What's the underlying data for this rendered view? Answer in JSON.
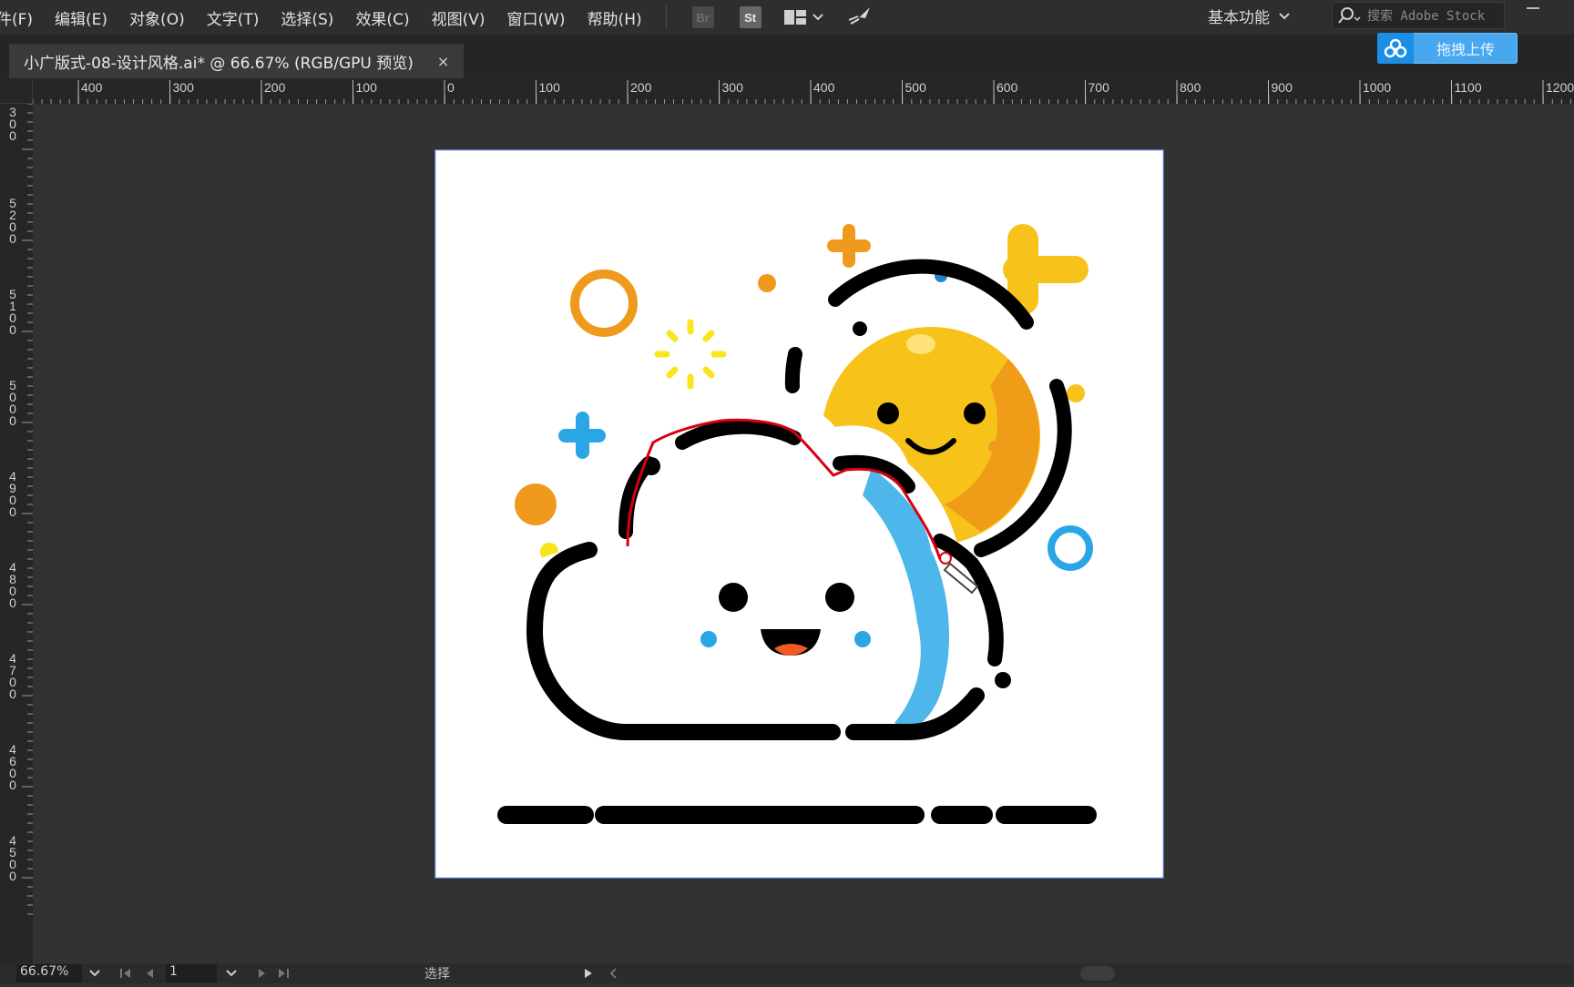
{
  "menubar": {
    "items": [
      "件(F)",
      "编辑(E)",
      "对象(O)",
      "文字(T)",
      "选择(S)",
      "效果(C)",
      "视图(V)",
      "窗口(W)",
      "帮助(H)"
    ],
    "bridge_label": "Br",
    "stock_label": "St"
  },
  "workspace": {
    "label": "基本功能"
  },
  "search": {
    "placeholder": "搜索 Adobe Stock"
  },
  "upload": {
    "label": "拖拽上传"
  },
  "document": {
    "tab_title": "小广版式-08-设计风格.ai* @ 66.67% (RGB/GPU 预览)",
    "close_symbol": "×"
  },
  "rulers": {
    "horizontal": [
      "400",
      "300",
      "200",
      "100",
      "0",
      "100",
      "200",
      "300",
      "400",
      "500",
      "600",
      "700",
      "800",
      "900",
      "1000",
      "1100",
      "1200"
    ],
    "vertical": [
      "300",
      "5200",
      "5100",
      "5000",
      "4900",
      "4800",
      "4700",
      "4600",
      "4500"
    ]
  },
  "statusbar": {
    "zoom": "66.67%",
    "page": "1",
    "mode": "选择"
  },
  "artwork": {
    "colors": {
      "sun": "#f7c31a",
      "sun_shadow": "#ef9d19",
      "orange": "#ef9a1c",
      "yellow": "#f9e51b",
      "blue": "#2aa6e6",
      "cloud_shadow": "#4db6ea",
      "outline": "#000000",
      "path": "#d80010",
      "mouth": "#f15a22",
      "artboard_border": "#4f73c7"
    }
  }
}
